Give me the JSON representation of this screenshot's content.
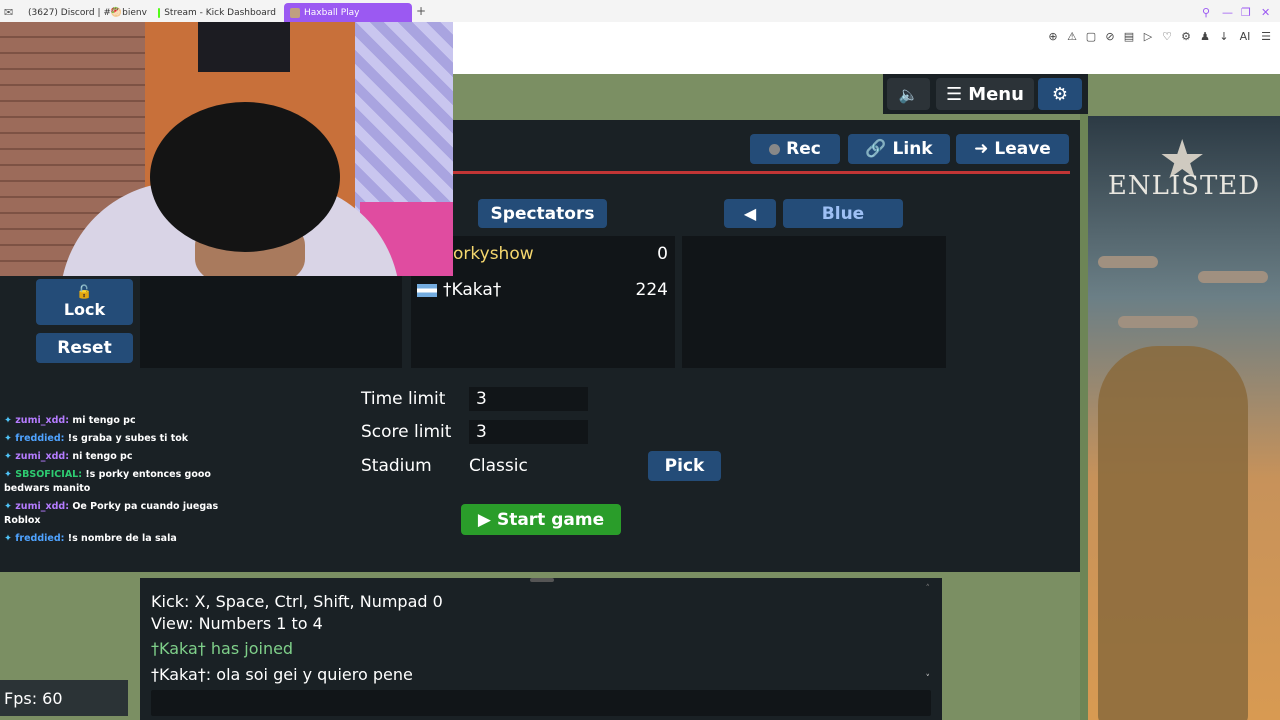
{
  "browser": {
    "tabs": [
      {
        "label": "(3627) Discord | #🥙bienv",
        "color": "#e74c3c"
      },
      {
        "label": "Stream - Kick Dashboard",
        "color": "#53fc18"
      },
      {
        "label": "Haxball Play",
        "color": "#c0a080",
        "active": true
      }
    ],
    "new_tab": "+",
    "toolbar_ai": "AI"
  },
  "game": {
    "topbar": {
      "menu_label": "Menu"
    },
    "room_buttons": {
      "rec": "Rec",
      "link": "Link",
      "leave": "Leave"
    },
    "teams": {
      "spectators": "Spectators",
      "blue": "Blue",
      "arrow": "◀"
    },
    "spectators": [
      {
        "name": "Porkyshow",
        "visible_name": "orkyshow",
        "score": "0"
      },
      {
        "name": "†Kaka†",
        "score": "224",
        "flag": "argentina"
      }
    ],
    "lock_label": "Lock",
    "reset_label": "Reset",
    "settings": {
      "time_limit_label": "Time limit",
      "time_limit_value": "3",
      "score_limit_label": "Score limit",
      "score_limit_value": "3",
      "stadium_label": "Stadium",
      "stadium_value": "Classic",
      "pick_label": "Pick"
    },
    "start_label": "Start game"
  },
  "stream_chat": [
    {
      "user": "zumi_xdd:",
      "text": "mi tengo pc",
      "color": "#b57cff"
    },
    {
      "user": "freddied:",
      "text": "!s graba y subes ti tok",
      "color": "#4fa3ff"
    },
    {
      "user": "zumi_xdd:",
      "text": "ni tengo pc",
      "color": "#b57cff"
    },
    {
      "user": "SBSOFICIAL:",
      "text": "!s porky entonces gooo bedwars manito",
      "color": "#2ecc71"
    },
    {
      "user": "zumi_xdd:",
      "text": "Oe Porky pa cuando juegas Roblox",
      "color": "#b57cff"
    },
    {
      "user": "freddied:",
      "text": "!s nombre de la sala",
      "color": "#4fa3ff"
    }
  ],
  "chat": {
    "lines": [
      {
        "text": "Kick: X, Space, Ctrl, Shift, Numpad 0",
        "color": "#ffffff"
      },
      {
        "text": "View: Numbers 1 to 4",
        "color": "#ffffff"
      },
      {
        "text": "†Kaka† has joined",
        "color": "#7fd08a"
      },
      {
        "text": "†Kaka†: ola soi gei y quiero pene",
        "color": "#ffffff"
      }
    ]
  },
  "fps": "Fps: 60",
  "ad": {
    "brand": "ENLISTED"
  },
  "colors": {
    "accent": "#244c78",
    "start": "#2a9d2a",
    "red_line": "#c13535"
  }
}
